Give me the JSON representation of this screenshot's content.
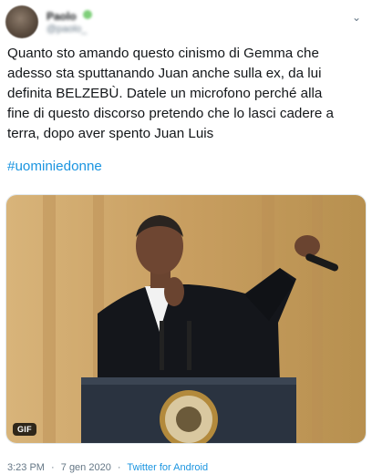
{
  "author": {
    "name": "Paolo",
    "handle": "@paolo_"
  },
  "tweet": {
    "text": "Quanto sto amando questo cinismo di Gemma che\nadesso sta sputtanando Juan anche sulla ex, da lui\ndefinita BELZEBÙ. Datele un microfono perché alla\nfine di questo discorso pretendo che lo lasci cadere a\nterra, dopo aver spento Juan Luis",
    "hashtag": "#uominiedonne"
  },
  "media": {
    "badge": "GIF"
  },
  "footer": {
    "time": "3:23 PM",
    "date": "7 gen 2020",
    "separator": "·",
    "source": "Twitter for Android"
  },
  "colors": {
    "link": "#1b95e0",
    "text": "#14171a",
    "muted": "#657786",
    "media_background": "#c9a46a"
  },
  "icons": {
    "menu": "chevron-down-icon",
    "verified": "verified-icon"
  }
}
